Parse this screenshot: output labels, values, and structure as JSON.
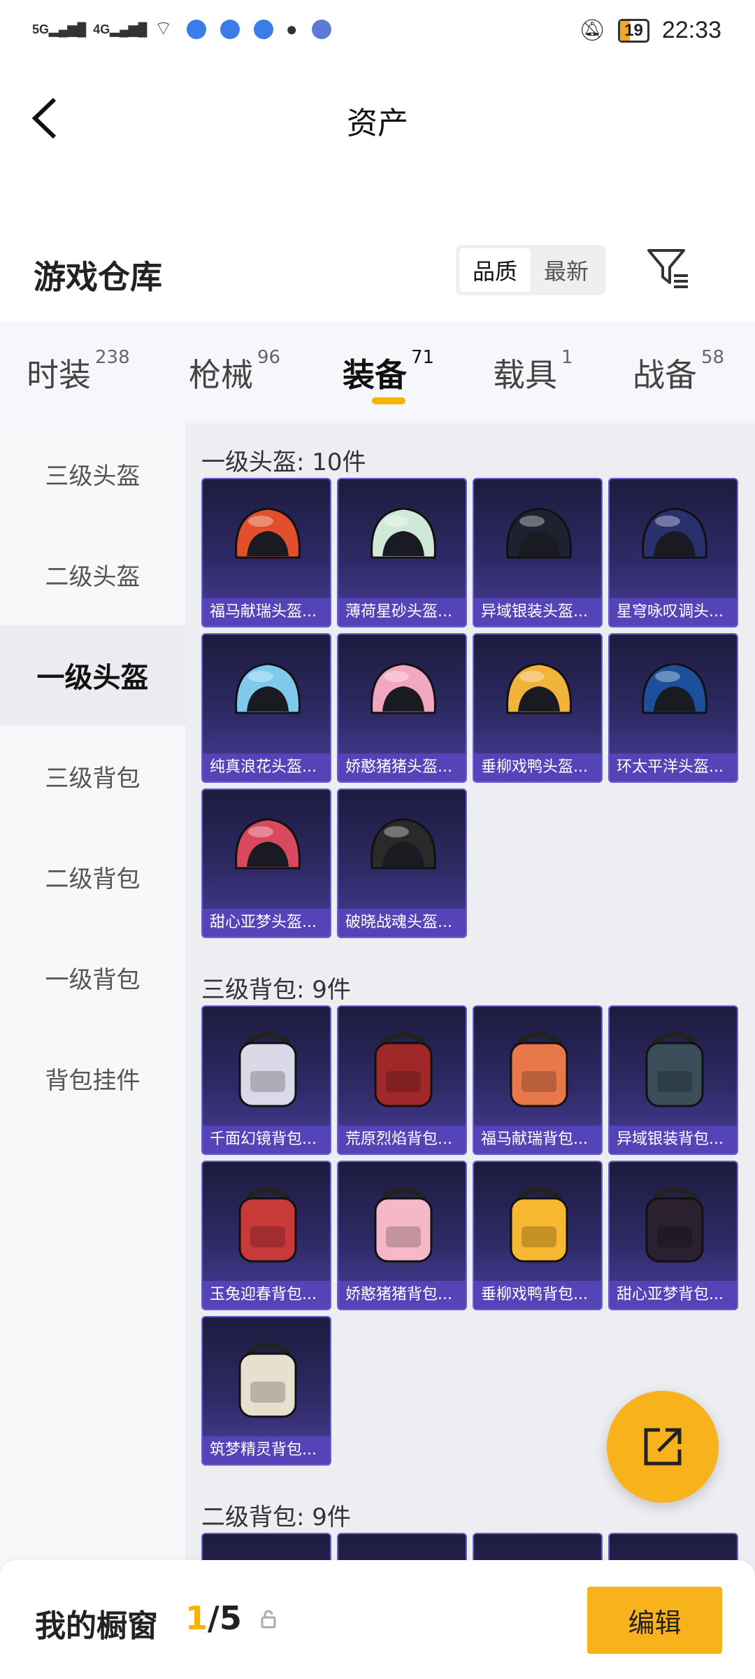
{
  "status_bar": {
    "network_left": "5G",
    "network_right": "4G",
    "battery": "19",
    "time": "22:33",
    "icons": [
      "hd-icon",
      "signal-5g-icon",
      "signal-4g-icon",
      "wifi-icon",
      "app-badge-icon",
      "app-badge-icon",
      "app-badge-icon",
      "qq-icon",
      "music-icon",
      "mute-icon",
      "battery-icon"
    ]
  },
  "header": {
    "title": "资产",
    "back_icon": "chevron-left-icon"
  },
  "warehouse": {
    "title": "游戏仓库",
    "sort": [
      "品质",
      "最新"
    ],
    "filter_icon": "filter-icon"
  },
  "tabs": [
    {
      "label": "时装",
      "count": "238"
    },
    {
      "label": "枪械",
      "count": "96"
    },
    {
      "label": "装备",
      "count": "71"
    },
    {
      "label": "载具",
      "count": "1"
    },
    {
      "label": "战备",
      "count": "58"
    }
  ],
  "sidebar": [
    "三级头盔",
    "二级头盔",
    "一级头盔",
    "三级背包",
    "二级背包",
    "一级背包",
    "背包挂件"
  ],
  "sections": [
    {
      "title": "一级头盔: 10件",
      "items": [
        "福马献瑞头盔...",
        "薄荷星砂头盔...",
        "异域银装头盔...",
        "星穹咏叹调头...",
        "纯真浪花头盔...",
        "娇憨猪猪头盔...",
        "垂柳戏鸭头盔...",
        "环太平洋头盔...",
        "甜心亚梦头盔...",
        "破晓战魂头盔..."
      ]
    },
    {
      "title": "三级背包: 9件",
      "items": [
        "千面幻镜背包...",
        "荒原烈焰背包...",
        "福马献瑞背包...",
        "异域银装背包...",
        "玉兔迎春背包...",
        "娇憨猪猪背包...",
        "垂柳戏鸭背包...",
        "甜心亚梦背包...",
        "筑梦精灵背包..."
      ]
    },
    {
      "title": "二级背包: 9件",
      "items": []
    }
  ],
  "colors": {
    "accent": "#f7b21c",
    "card_top": "#1d1b3e",
    "card_bottom": "#4a3f9a",
    "label_bg": "#5544b8"
  },
  "bottom": {
    "title": "我的橱窗",
    "current": "1",
    "total": "/5",
    "edit": "编辑"
  },
  "fab_icon": "share-icon"
}
